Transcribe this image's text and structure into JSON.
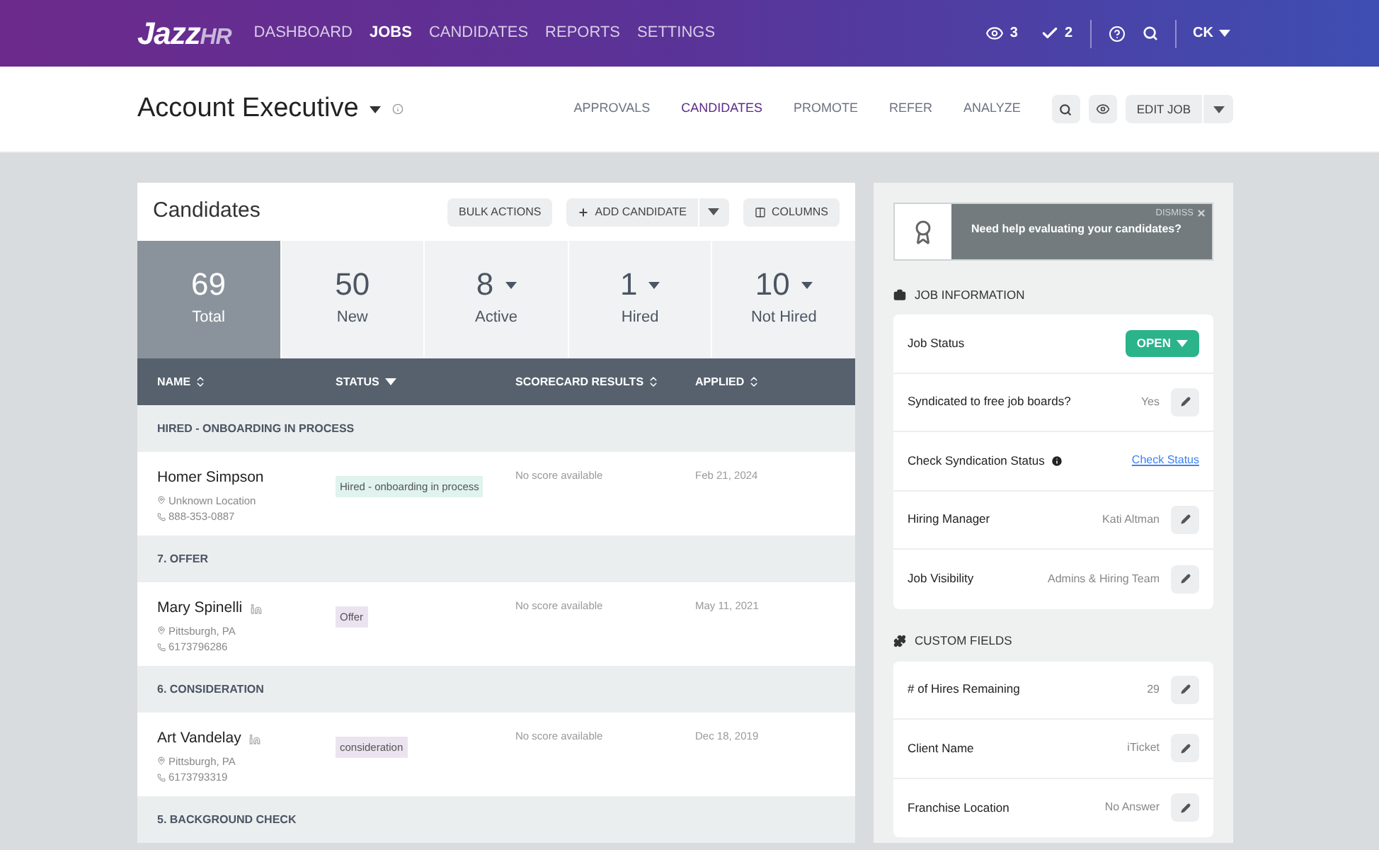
{
  "nav": {
    "logo_main": "Jazz",
    "logo_accent": "HR",
    "items": [
      {
        "label": "DASHBOARD",
        "selected": false
      },
      {
        "label": "JOBS",
        "selected": true
      },
      {
        "label": "CANDIDATES",
        "selected": false
      },
      {
        "label": "REPORTS",
        "selected": false
      },
      {
        "label": "SETTINGS",
        "selected": false
      }
    ],
    "views_count": "3",
    "tasks_count": "2",
    "user": "CK"
  },
  "job": {
    "title": "Account Executive",
    "tabs": [
      {
        "label": "APPROVALS",
        "selected": false
      },
      {
        "label": "CANDIDATES",
        "selected": true
      },
      {
        "label": "PROMOTE",
        "selected": false
      },
      {
        "label": "REFER",
        "selected": false
      },
      {
        "label": "ANALYZE",
        "selected": false
      }
    ],
    "edit_button": "EDIT JOB"
  },
  "candidates": {
    "title": "Candidates",
    "bulk_actions": "BULK ACTIONS",
    "add_candidate": "ADD CANDIDATE",
    "columns_button": "COLUMNS",
    "stats": [
      {
        "value": "69",
        "label": "Total",
        "selected": true,
        "dropdown": false
      },
      {
        "value": "50",
        "label": "New",
        "selected": false,
        "dropdown": false
      },
      {
        "value": "8",
        "label": "Active",
        "selected": false,
        "dropdown": true
      },
      {
        "value": "1",
        "label": "Hired",
        "selected": false,
        "dropdown": true
      },
      {
        "value": "10",
        "label": "Not Hired",
        "selected": false,
        "dropdown": true
      }
    ],
    "columns": [
      {
        "label": "NAME"
      },
      {
        "label": "STATUS"
      },
      {
        "label": "SCORECARD RESULTS"
      },
      {
        "label": "APPLIED"
      }
    ],
    "groups": [
      {
        "title": "HIRED - ONBOARDING IN PROCESS",
        "rows": [
          {
            "name": "Homer Simpson",
            "linkedin": false,
            "location": "Unknown Location",
            "phone": "888-353-0887",
            "status": "Hired - onboarding in process",
            "color": "#e0f3ee",
            "score": "No score available",
            "applied": "Feb 21, 2024"
          }
        ]
      },
      {
        "title": "7. OFFER",
        "rows": [
          {
            "name": "Mary Spinelli",
            "linkedin": true,
            "location": "Pittsburgh, PA",
            "phone": "6173796286",
            "status": "Offer",
            "color": "#ece3f0",
            "score": "No score available",
            "applied": "May 11, 2021"
          }
        ]
      },
      {
        "title": "6. CONSIDERATION",
        "rows": [
          {
            "name": "Art Vandelay",
            "linkedin": true,
            "location": "Pittsburgh, PA",
            "phone": "6173793319",
            "status": "consideration",
            "color": "#ece3f0",
            "score": "No score available",
            "applied": "Dec 18, 2019"
          }
        ]
      },
      {
        "title": "5. BACKGROUND CHECK"
      }
    ]
  },
  "sidebar": {
    "promo": {
      "dismiss": "DISMISS",
      "text": "Need help evaluating your candidates?"
    },
    "sections": [
      {
        "title": "JOB INFORMATION",
        "fields": [
          {
            "kind": "status",
            "label": "Job Status",
            "value": "OPEN"
          },
          {
            "kind": "edit",
            "label": "Syndicated to free job boards?",
            "value": "Yes"
          },
          {
            "kind": "link",
            "label": "Check Syndication Status",
            "value": "Check Status"
          },
          {
            "kind": "edit",
            "label": "Hiring Manager",
            "value": "Kati Altman"
          },
          {
            "kind": "edit",
            "label": "Job Visibility",
            "value": "Admins & Hiring Team"
          }
        ]
      },
      {
        "title": "CUSTOM FIELDS",
        "fields": [
          {
            "kind": "edit",
            "label": "# of Hires Remaining",
            "value": "29"
          },
          {
            "kind": "edit",
            "label": "Client Name",
            "value": "iTicket"
          },
          {
            "kind": "edit",
            "label": "Franchise Location",
            "value": "No Answer"
          }
        ]
      }
    ]
  }
}
